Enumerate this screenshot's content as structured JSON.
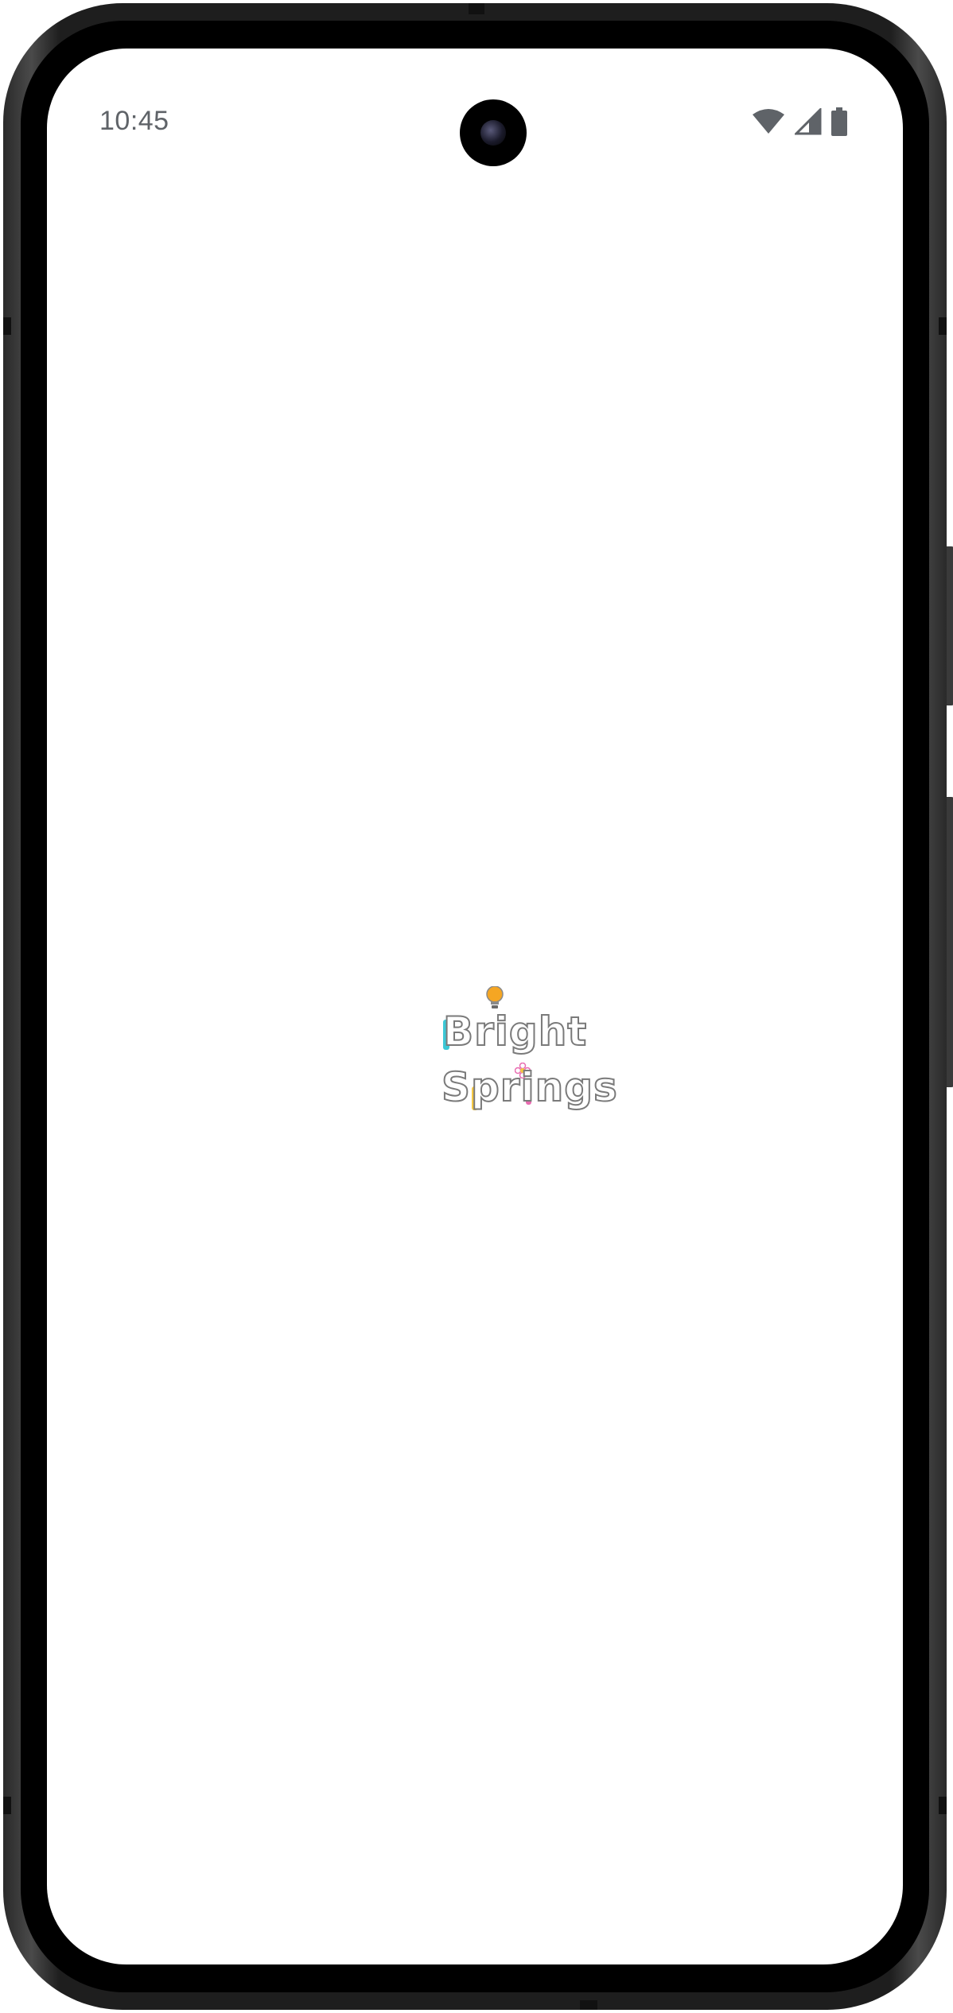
{
  "status_bar": {
    "time": "10:45",
    "icons": [
      "wifi-icon",
      "cellular-signal-icon",
      "battery-icon"
    ]
  },
  "splash": {
    "logo_line1": "Bright",
    "logo_line2": "Springs",
    "accent_colors": {
      "cyan": "#3cc8d6",
      "yellow": "#f5c842",
      "pink": "#e86bb0",
      "bulb": "#f5a623"
    }
  },
  "colors": {
    "screen_background": "#ffffff",
    "status_text": "#5f6368",
    "home_indicator": "#6b6b6b"
  }
}
